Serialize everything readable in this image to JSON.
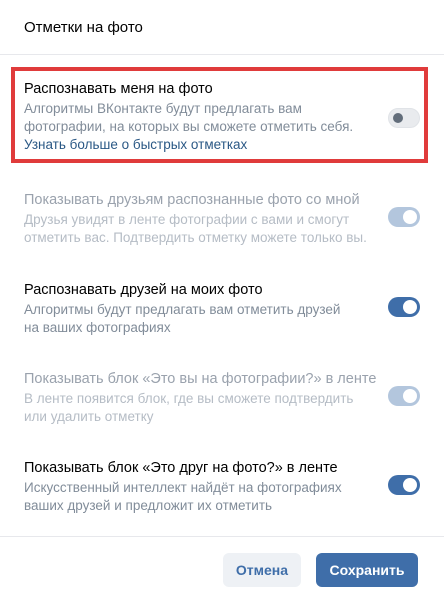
{
  "header": {
    "title": "Отметки на фото"
  },
  "settings": [
    {
      "title": "Распознавать меня на фото",
      "desc1": "Алгоритмы ВКонтакте будут предлагать вам",
      "desc2": "фотографии, на которых вы сможете отметить себя.",
      "link": "Узнать больше о быстрых отметках",
      "enabled": false
    },
    {
      "title": "Показывать друзьям распознанные фото со мной",
      "desc1": "Друзья увидят в ленте фотографии с вами и смогут",
      "desc2": "отметить вас. Подтвердить отметку можете только вы.",
      "enabled": true
    },
    {
      "title": "Распознавать друзей на моих фото",
      "desc1": "Алгоритмы будут предлагать вам отметить друзей",
      "desc2": "на ваших фотографиях",
      "enabled": true
    },
    {
      "title": "Показывать блок «Это вы на фотографии?» в ленте",
      "desc1": "В ленте появится блок, где вы сможете подтвердить",
      "desc2": "или удалить отметку",
      "enabled": true
    },
    {
      "title": "Показывать блок «Это друг на фото?» в ленте",
      "desc1": "Искусственный интеллект найдёт на фотографиях",
      "desc2": "ваших друзей и предложит их отметить",
      "enabled": true
    }
  ],
  "footer": {
    "cancel_label": "Отмена",
    "save_label": "Сохранить"
  },
  "colors": {
    "accent": "#3f6ea9",
    "highlight": "#e03b3b",
    "link": "#2a5885"
  }
}
